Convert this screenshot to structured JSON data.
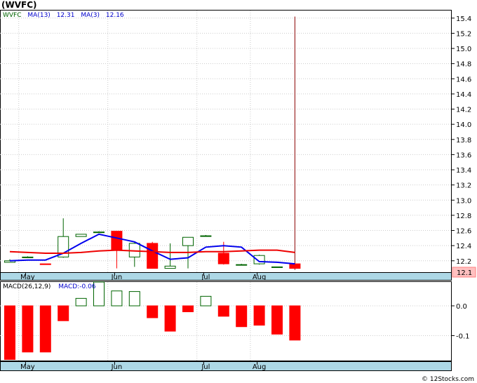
{
  "title": "(WVFC)",
  "watermark": "© 12Stocks.com",
  "price_panel": {
    "legend": {
      "symbol": "WVFC",
      "ma13_label": "MA(13)",
      "ma13_value": "12.31",
      "ma3_label": "MA(3)",
      "ma3_value": "12.16"
    },
    "last_price_label": "12.1",
    "y_ticks": [
      "15.4",
      "15.2",
      "15.0",
      "14.8",
      "14.6",
      "14.4",
      "14.2",
      "14.0",
      "13.8",
      "13.6",
      "13.4",
      "13.2",
      "13.0",
      "12.8",
      "12.6",
      "12.4",
      "12.2"
    ],
    "x_labels": [
      "May",
      "Jun",
      "Jul",
      "Aug"
    ]
  },
  "macd_panel": {
    "legend": {
      "label": "MACD(26,12,9)",
      "value_label": "MACD:-0.06"
    },
    "y_ticks": [
      "0.0",
      "-0.1"
    ],
    "x_labels": [
      "May",
      "Jun",
      "Jul",
      "Aug"
    ]
  },
  "colors": {
    "up": "#006400",
    "down": "#ff0000",
    "ma_fast": "#0000ee",
    "ma_slow": "#ee0000",
    "axis_band": "#add8e6",
    "grid": "#cccccc",
    "spike": "#8b0000"
  },
  "chart_data": [
    {
      "type": "candlestick",
      "title": "(WVFC)",
      "frequency": "weekly",
      "ylim": [
        12.05,
        15.5
      ],
      "x_axis_months": [
        "May",
        "Jun",
        "Jul",
        "Aug"
      ],
      "candles": [
        {
          "open": 12.18,
          "high": 12.22,
          "low": 12.18,
          "close": 12.2
        },
        {
          "open": 12.24,
          "high": 12.26,
          "low": 12.24,
          "close": 12.25
        },
        {
          "open": 12.16,
          "high": 12.16,
          "low": 12.15,
          "close": 12.15
        },
        {
          "open": 12.25,
          "high": 12.76,
          "low": 12.24,
          "close": 12.52
        },
        {
          "open": 12.52,
          "high": 12.55,
          "low": 12.52,
          "close": 12.55
        },
        {
          "open": 12.58,
          "high": 12.59,
          "low": 12.58,
          "close": 12.58
        },
        {
          "open": 12.59,
          "high": 12.59,
          "low": 12.1,
          "close": 12.35
        },
        {
          "open": 12.25,
          "high": 12.44,
          "low": 12.12,
          "close": 12.43
        },
        {
          "open": 12.43,
          "high": 12.45,
          "low": 12.1,
          "close": 12.1
        },
        {
          "open": 12.1,
          "high": 12.43,
          "low": 12.1,
          "close": 12.13
        },
        {
          "open": 12.4,
          "high": 12.51,
          "low": 12.1,
          "close": 12.51
        },
        {
          "open": 12.53,
          "high": 12.54,
          "low": 12.53,
          "close": 12.53
        },
        {
          "open": 12.3,
          "high": 12.45,
          "low": 12.15,
          "close": 12.16
        },
        {
          "open": 12.15,
          "high": 12.16,
          "low": 12.15,
          "close": 12.15
        },
        {
          "open": 12.16,
          "high": 12.28,
          "low": 12.15,
          "close": 12.27
        },
        {
          "open": 12.12,
          "high": 12.12,
          "low": 12.12,
          "close": 12.12
        },
        {
          "open": 12.16,
          "high": 15.42,
          "low": 12.08,
          "close": 12.1
        }
      ],
      "series": [
        {
          "name": "MA(3)",
          "values": [
            12.2,
            12.21,
            12.21,
            12.3,
            12.43,
            12.55,
            12.5,
            12.45,
            12.33,
            12.22,
            12.24,
            12.38,
            12.4,
            12.38,
            12.19,
            12.18,
            12.16
          ]
        },
        {
          "name": "MA(13)",
          "values": [
            12.32,
            12.31,
            12.3,
            12.3,
            12.31,
            12.33,
            12.34,
            12.33,
            12.32,
            12.31,
            12.31,
            12.32,
            12.32,
            12.33,
            12.34,
            12.34,
            12.31
          ]
        }
      ]
    },
    {
      "type": "bar",
      "title": "MACD(26,12,9)",
      "ylim": [
        -0.186,
        0.08
      ],
      "x_axis_months": [
        "May",
        "Jun",
        "Jul",
        "Aug"
      ],
      "values": [
        -0.18,
        -0.155,
        -0.155,
        -0.05,
        0.025,
        0.08,
        0.05,
        0.048,
        -0.04,
        -0.085,
        -0.02,
        0.032,
        -0.035,
        -0.07,
        -0.065,
        -0.095,
        -0.115
      ]
    }
  ]
}
